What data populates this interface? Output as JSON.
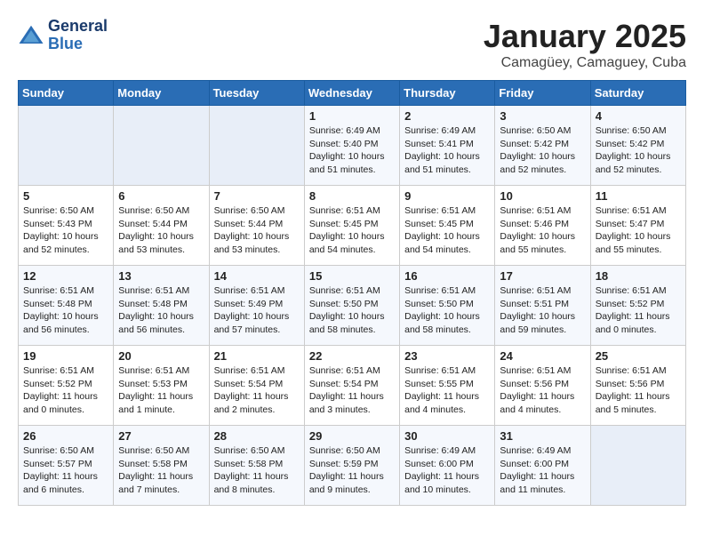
{
  "logo": {
    "line1": "General",
    "line2": "Blue"
  },
  "title": "January 2025",
  "location": "Camagüey, Camaguey, Cuba",
  "weekdays": [
    "Sunday",
    "Monday",
    "Tuesday",
    "Wednesday",
    "Thursday",
    "Friday",
    "Saturday"
  ],
  "weeks": [
    [
      {
        "day": "",
        "sunrise": "",
        "sunset": "",
        "daylight": ""
      },
      {
        "day": "",
        "sunrise": "",
        "sunset": "",
        "daylight": ""
      },
      {
        "day": "",
        "sunrise": "",
        "sunset": "",
        "daylight": ""
      },
      {
        "day": "1",
        "sunrise": "Sunrise: 6:49 AM",
        "sunset": "Sunset: 5:40 PM",
        "daylight": "Daylight: 10 hours and 51 minutes."
      },
      {
        "day": "2",
        "sunrise": "Sunrise: 6:49 AM",
        "sunset": "Sunset: 5:41 PM",
        "daylight": "Daylight: 10 hours and 51 minutes."
      },
      {
        "day": "3",
        "sunrise": "Sunrise: 6:50 AM",
        "sunset": "Sunset: 5:42 PM",
        "daylight": "Daylight: 10 hours and 52 minutes."
      },
      {
        "day": "4",
        "sunrise": "Sunrise: 6:50 AM",
        "sunset": "Sunset: 5:42 PM",
        "daylight": "Daylight: 10 hours and 52 minutes."
      }
    ],
    [
      {
        "day": "5",
        "sunrise": "Sunrise: 6:50 AM",
        "sunset": "Sunset: 5:43 PM",
        "daylight": "Daylight: 10 hours and 52 minutes."
      },
      {
        "day": "6",
        "sunrise": "Sunrise: 6:50 AM",
        "sunset": "Sunset: 5:44 PM",
        "daylight": "Daylight: 10 hours and 53 minutes."
      },
      {
        "day": "7",
        "sunrise": "Sunrise: 6:50 AM",
        "sunset": "Sunset: 5:44 PM",
        "daylight": "Daylight: 10 hours and 53 minutes."
      },
      {
        "day": "8",
        "sunrise": "Sunrise: 6:51 AM",
        "sunset": "Sunset: 5:45 PM",
        "daylight": "Daylight: 10 hours and 54 minutes."
      },
      {
        "day": "9",
        "sunrise": "Sunrise: 6:51 AM",
        "sunset": "Sunset: 5:45 PM",
        "daylight": "Daylight: 10 hours and 54 minutes."
      },
      {
        "day": "10",
        "sunrise": "Sunrise: 6:51 AM",
        "sunset": "Sunset: 5:46 PM",
        "daylight": "Daylight: 10 hours and 55 minutes."
      },
      {
        "day": "11",
        "sunrise": "Sunrise: 6:51 AM",
        "sunset": "Sunset: 5:47 PM",
        "daylight": "Daylight: 10 hours and 55 minutes."
      }
    ],
    [
      {
        "day": "12",
        "sunrise": "Sunrise: 6:51 AM",
        "sunset": "Sunset: 5:48 PM",
        "daylight": "Daylight: 10 hours and 56 minutes."
      },
      {
        "day": "13",
        "sunrise": "Sunrise: 6:51 AM",
        "sunset": "Sunset: 5:48 PM",
        "daylight": "Daylight: 10 hours and 56 minutes."
      },
      {
        "day": "14",
        "sunrise": "Sunrise: 6:51 AM",
        "sunset": "Sunset: 5:49 PM",
        "daylight": "Daylight: 10 hours and 57 minutes."
      },
      {
        "day": "15",
        "sunrise": "Sunrise: 6:51 AM",
        "sunset": "Sunset: 5:50 PM",
        "daylight": "Daylight: 10 hours and 58 minutes."
      },
      {
        "day": "16",
        "sunrise": "Sunrise: 6:51 AM",
        "sunset": "Sunset: 5:50 PM",
        "daylight": "Daylight: 10 hours and 58 minutes."
      },
      {
        "day": "17",
        "sunrise": "Sunrise: 6:51 AM",
        "sunset": "Sunset: 5:51 PM",
        "daylight": "Daylight: 10 hours and 59 minutes."
      },
      {
        "day": "18",
        "sunrise": "Sunrise: 6:51 AM",
        "sunset": "Sunset: 5:52 PM",
        "daylight": "Daylight: 11 hours and 0 minutes."
      }
    ],
    [
      {
        "day": "19",
        "sunrise": "Sunrise: 6:51 AM",
        "sunset": "Sunset: 5:52 PM",
        "daylight": "Daylight: 11 hours and 0 minutes."
      },
      {
        "day": "20",
        "sunrise": "Sunrise: 6:51 AM",
        "sunset": "Sunset: 5:53 PM",
        "daylight": "Daylight: 11 hours and 1 minute."
      },
      {
        "day": "21",
        "sunrise": "Sunrise: 6:51 AM",
        "sunset": "Sunset: 5:54 PM",
        "daylight": "Daylight: 11 hours and 2 minutes."
      },
      {
        "day": "22",
        "sunrise": "Sunrise: 6:51 AM",
        "sunset": "Sunset: 5:54 PM",
        "daylight": "Daylight: 11 hours and 3 minutes."
      },
      {
        "day": "23",
        "sunrise": "Sunrise: 6:51 AM",
        "sunset": "Sunset: 5:55 PM",
        "daylight": "Daylight: 11 hours and 4 minutes."
      },
      {
        "day": "24",
        "sunrise": "Sunrise: 6:51 AM",
        "sunset": "Sunset: 5:56 PM",
        "daylight": "Daylight: 11 hours and 4 minutes."
      },
      {
        "day": "25",
        "sunrise": "Sunrise: 6:51 AM",
        "sunset": "Sunset: 5:56 PM",
        "daylight": "Daylight: 11 hours and 5 minutes."
      }
    ],
    [
      {
        "day": "26",
        "sunrise": "Sunrise: 6:50 AM",
        "sunset": "Sunset: 5:57 PM",
        "daylight": "Daylight: 11 hours and 6 minutes."
      },
      {
        "day": "27",
        "sunrise": "Sunrise: 6:50 AM",
        "sunset": "Sunset: 5:58 PM",
        "daylight": "Daylight: 11 hours and 7 minutes."
      },
      {
        "day": "28",
        "sunrise": "Sunrise: 6:50 AM",
        "sunset": "Sunset: 5:58 PM",
        "daylight": "Daylight: 11 hours and 8 minutes."
      },
      {
        "day": "29",
        "sunrise": "Sunrise: 6:50 AM",
        "sunset": "Sunset: 5:59 PM",
        "daylight": "Daylight: 11 hours and 9 minutes."
      },
      {
        "day": "30",
        "sunrise": "Sunrise: 6:49 AM",
        "sunset": "Sunset: 6:00 PM",
        "daylight": "Daylight: 11 hours and 10 minutes."
      },
      {
        "day": "31",
        "sunrise": "Sunrise: 6:49 AM",
        "sunset": "Sunset: 6:00 PM",
        "daylight": "Daylight: 11 hours and 11 minutes."
      },
      {
        "day": "",
        "sunrise": "",
        "sunset": "",
        "daylight": ""
      }
    ]
  ]
}
